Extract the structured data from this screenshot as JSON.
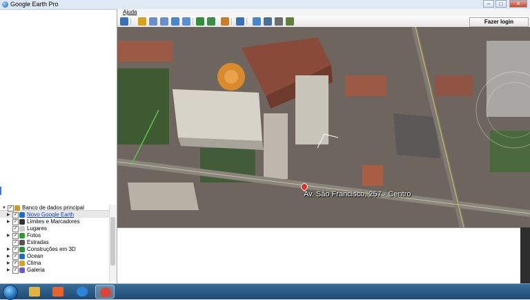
{
  "window": {
    "title": "Google Earth Pro"
  },
  "window_controls": {
    "minimize": "–",
    "maximize": "□",
    "close": "✕"
  },
  "menu": {
    "help_label": "Ajuda"
  },
  "toolbar": {
    "login_label": "Fazer login",
    "buttons": [
      {
        "icon": "sidebar-toggle-icon",
        "color": "#3b6fb6"
      },
      {
        "icon": "placemark-add-icon",
        "color": "#d4a21c"
      },
      {
        "icon": "polygon-add-icon",
        "color": "#6b8fc7"
      },
      {
        "icon": "path-add-icon",
        "color": "#6b8fc7"
      },
      {
        "icon": "overlay-add-icon",
        "color": "#4a86c9"
      },
      {
        "icon": "tour-record-icon",
        "color": "#5a8fcf"
      },
      {
        "icon": "historical-imagery-icon",
        "color": "#2f8f3a"
      },
      {
        "icon": "sunlight-icon",
        "color": "#3d8b46"
      },
      {
        "icon": "planet-switch-icon",
        "color": "#c77e2a"
      },
      {
        "icon": "ruler-icon",
        "color": "#3b6fb6"
      },
      {
        "icon": "email-icon",
        "color": "#4a86c9"
      },
      {
        "icon": "print-icon",
        "color": "#4a6f96"
      },
      {
        "icon": "save-image-icon",
        "color": "#6c6c6c"
      },
      {
        "icon": "view-in-maps-icon",
        "color": "#5f7f3a"
      }
    ]
  },
  "map": {
    "address_label": "Av. São Francisco, 257 - Centro"
  },
  "layers": [
    {
      "label": "Banco de dados principal",
      "icon": "database-icon",
      "color": "#c89b2a",
      "expand": "▼",
      "level": 0,
      "link": false
    },
    {
      "label": "Novo Google Earth",
      "icon": "globe-icon",
      "color": "#1b6fc9",
      "expand": "▶",
      "level": 1,
      "link": true
    },
    {
      "label": "Limites e Marcadores",
      "icon": "flag-icon",
      "color": "#333333",
      "expand": "▶",
      "level": 1,
      "link": false
    },
    {
      "label": "Lugares",
      "icon": "places-icon",
      "color": "#cccccc",
      "expand": "",
      "level": 1,
      "link": false
    },
    {
      "label": "Fotos",
      "icon": "photo-icon",
      "color": "#2d9a3a",
      "expand": "▶",
      "level": 1,
      "link": false
    },
    {
      "label": "Estradas",
      "icon": "roads-icon",
      "color": "#555555",
      "expand": "",
      "level": 1,
      "link": false
    },
    {
      "label": "Construções em 3D",
      "icon": "buildings-3d-icon",
      "color": "#2f8f3a",
      "expand": "▶",
      "level": 1,
      "link": false
    },
    {
      "label": "Ocean",
      "icon": "ocean-icon",
      "color": "#1f6fb5",
      "expand": "▶",
      "level": 1,
      "link": false
    },
    {
      "label": "Clima",
      "icon": "weather-icon",
      "color": "#d9a21c",
      "expand": "▶",
      "level": 1,
      "link": false
    },
    {
      "label": "Galeria",
      "icon": "gallery-icon",
      "color": "#6a5acd",
      "expand": "▶",
      "level": 1,
      "link": false
    }
  ],
  "taskbar": {
    "items": [
      {
        "icon": "file-explorer-icon",
        "color": "#e3b341",
        "active": false
      },
      {
        "icon": "media-player-icon",
        "color": "#e8642c",
        "active": false
      },
      {
        "icon": "internet-explorer-icon",
        "color": "#2b84d8",
        "active": false
      },
      {
        "icon": "chrome-icon",
        "color": "#db4437",
        "active": true
      }
    ]
  }
}
